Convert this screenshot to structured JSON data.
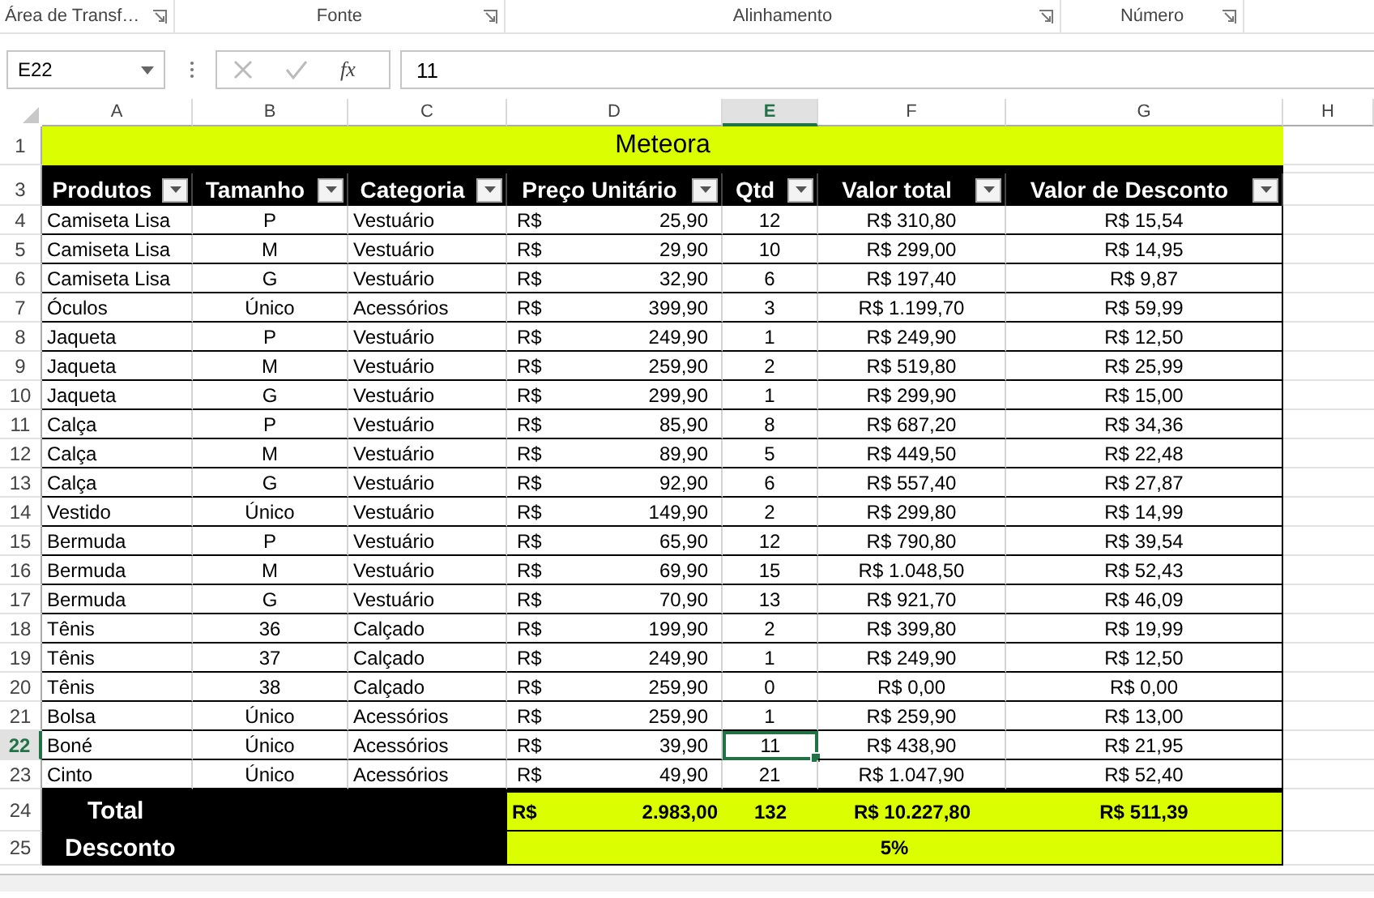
{
  "ribbon_groups": [
    {
      "label": "Área de Transf…"
    },
    {
      "label": "Fonte"
    },
    {
      "label": "Alinhamento"
    },
    {
      "label": "Número"
    }
  ],
  "formula_bar": {
    "name_box": "E22",
    "function_label": "fx",
    "value": "11"
  },
  "column_headers": [
    {
      "label": "A",
      "selected": false
    },
    {
      "label": "B",
      "selected": false
    },
    {
      "label": "C",
      "selected": false
    },
    {
      "label": "D",
      "selected": false
    },
    {
      "label": "E",
      "selected": true
    },
    {
      "label": "F",
      "selected": false
    },
    {
      "label": "G",
      "selected": false
    },
    {
      "label": "H",
      "selected": false
    }
  ],
  "title": {
    "row_number": "1",
    "text": "Meteora"
  },
  "table": {
    "row_number": "3",
    "columns": [
      {
        "label": "Produtos"
      },
      {
        "label": "Tamanho"
      },
      {
        "label": "Categoria"
      },
      {
        "label": "Preço Unitário"
      },
      {
        "label": "Qtd"
      },
      {
        "label": "Valor total"
      },
      {
        "label": "Valor de Desconto"
      }
    ],
    "rows": [
      {
        "row_number": "4",
        "selected": false,
        "product": "Camiseta Lisa",
        "size": "P",
        "category": "Vestuário",
        "currency": "R$",
        "unit_price": "25,90",
        "quantity": "12",
        "total": "R$ 310,80",
        "discount": "R$ 15,54"
      },
      {
        "row_number": "5",
        "selected": false,
        "product": "Camiseta Lisa",
        "size": "M",
        "category": "Vestuário",
        "currency": "R$",
        "unit_price": "29,90",
        "quantity": "10",
        "total": "R$ 299,00",
        "discount": "R$ 14,95"
      },
      {
        "row_number": "6",
        "selected": false,
        "product": "Camiseta Lisa",
        "size": "G",
        "category": "Vestuário",
        "currency": "R$",
        "unit_price": "32,90",
        "quantity": "6",
        "total": "R$ 197,40",
        "discount": "R$ 9,87"
      },
      {
        "row_number": "7",
        "selected": false,
        "product": "Óculos",
        "size": "Único",
        "category": "Acessórios",
        "currency": "R$",
        "unit_price": "399,90",
        "quantity": "3",
        "total": "R$ 1.199,70",
        "discount": "R$ 59,99"
      },
      {
        "row_number": "8",
        "selected": false,
        "product": "Jaqueta",
        "size": "P",
        "category": "Vestuário",
        "currency": "R$",
        "unit_price": "249,90",
        "quantity": "1",
        "total": "R$ 249,90",
        "discount": "R$ 12,50"
      },
      {
        "row_number": "9",
        "selected": false,
        "product": "Jaqueta",
        "size": "M",
        "category": "Vestuário",
        "currency": "R$",
        "unit_price": "259,90",
        "quantity": "2",
        "total": "R$ 519,80",
        "discount": "R$ 25,99"
      },
      {
        "row_number": "10",
        "selected": false,
        "product": "Jaqueta",
        "size": "G",
        "category": "Vestuário",
        "currency": "R$",
        "unit_price": "299,90",
        "quantity": "1",
        "total": "R$ 299,90",
        "discount": "R$ 15,00"
      },
      {
        "row_number": "11",
        "selected": false,
        "product": "Calça",
        "size": "P",
        "category": "Vestuário",
        "currency": "R$",
        "unit_price": "85,90",
        "quantity": "8",
        "total": "R$ 687,20",
        "discount": "R$ 34,36"
      },
      {
        "row_number": "12",
        "selected": false,
        "product": "Calça",
        "size": "M",
        "category": "Vestuário",
        "currency": "R$",
        "unit_price": "89,90",
        "quantity": "5",
        "total": "R$ 449,50",
        "discount": "R$ 22,48"
      },
      {
        "row_number": "13",
        "selected": false,
        "product": "Calça",
        "size": "G",
        "category": "Vestuário",
        "currency": "R$",
        "unit_price": "92,90",
        "quantity": "6",
        "total": "R$ 557,40",
        "discount": "R$ 27,87"
      },
      {
        "row_number": "14",
        "selected": false,
        "product": "Vestido",
        "size": "Único",
        "category": "Vestuário",
        "currency": "R$",
        "unit_price": "149,90",
        "quantity": "2",
        "total": "R$ 299,80",
        "discount": "R$ 14,99"
      },
      {
        "row_number": "15",
        "selected": false,
        "product": "Bermuda",
        "size": "P",
        "category": "Vestuário",
        "currency": "R$",
        "unit_price": "65,90",
        "quantity": "12",
        "total": "R$ 790,80",
        "discount": "R$ 39,54"
      },
      {
        "row_number": "16",
        "selected": false,
        "product": "Bermuda",
        "size": "M",
        "category": "Vestuário",
        "currency": "R$",
        "unit_price": "69,90",
        "quantity": "15",
        "total": "R$ 1.048,50",
        "discount": "R$ 52,43"
      },
      {
        "row_number": "17",
        "selected": false,
        "product": "Bermuda",
        "size": "G",
        "category": "Vestuário",
        "currency": "R$",
        "unit_price": "70,90",
        "quantity": "13",
        "total": "R$ 921,70",
        "discount": "R$ 46,09"
      },
      {
        "row_number": "18",
        "selected": false,
        "product": "Tênis",
        "size": "36",
        "category": "Calçado",
        "currency": "R$",
        "unit_price": "199,90",
        "quantity": "2",
        "total": "R$ 399,80",
        "discount": "R$ 19,99"
      },
      {
        "row_number": "19",
        "selected": false,
        "product": "Tênis",
        "size": "37",
        "category": "Calçado",
        "currency": "R$",
        "unit_price": "249,90",
        "quantity": "1",
        "total": "R$ 249,90",
        "discount": "R$ 12,50"
      },
      {
        "row_number": "20",
        "selected": false,
        "product": "Tênis",
        "size": "38",
        "category": "Calçado",
        "currency": "R$",
        "unit_price": "259,90",
        "quantity": "0",
        "total": "R$ 0,00",
        "discount": "R$ 0,00"
      },
      {
        "row_number": "21",
        "selected": false,
        "product": "Bolsa",
        "size": "Único",
        "category": "Acessórios",
        "currency": "R$",
        "unit_price": "259,90",
        "quantity": "1",
        "total": "R$ 259,90",
        "discount": "R$ 13,00"
      },
      {
        "row_number": "22",
        "selected": true,
        "product": "Boné",
        "size": "Único",
        "category": "Acessórios",
        "currency": "R$",
        "unit_price": "39,90",
        "quantity": "11",
        "total": "R$ 438,90",
        "discount": "R$ 21,95"
      },
      {
        "row_number": "23",
        "selected": false,
        "product": "Cinto",
        "size": "Único",
        "category": "Acessórios",
        "currency": "R$",
        "unit_price": "49,90",
        "quantity": "21",
        "total": "R$ 1.047,90",
        "discount": "R$ 52,40"
      }
    ]
  },
  "totals": {
    "row_number": "24",
    "label": "Total",
    "currency": "R$",
    "price": "2.983,00",
    "quantity": "132",
    "total": "R$ 10.227,80",
    "discount": "R$ 511,39"
  },
  "discount": {
    "row_number": "25",
    "label": "Desconto",
    "value": "5%"
  }
}
